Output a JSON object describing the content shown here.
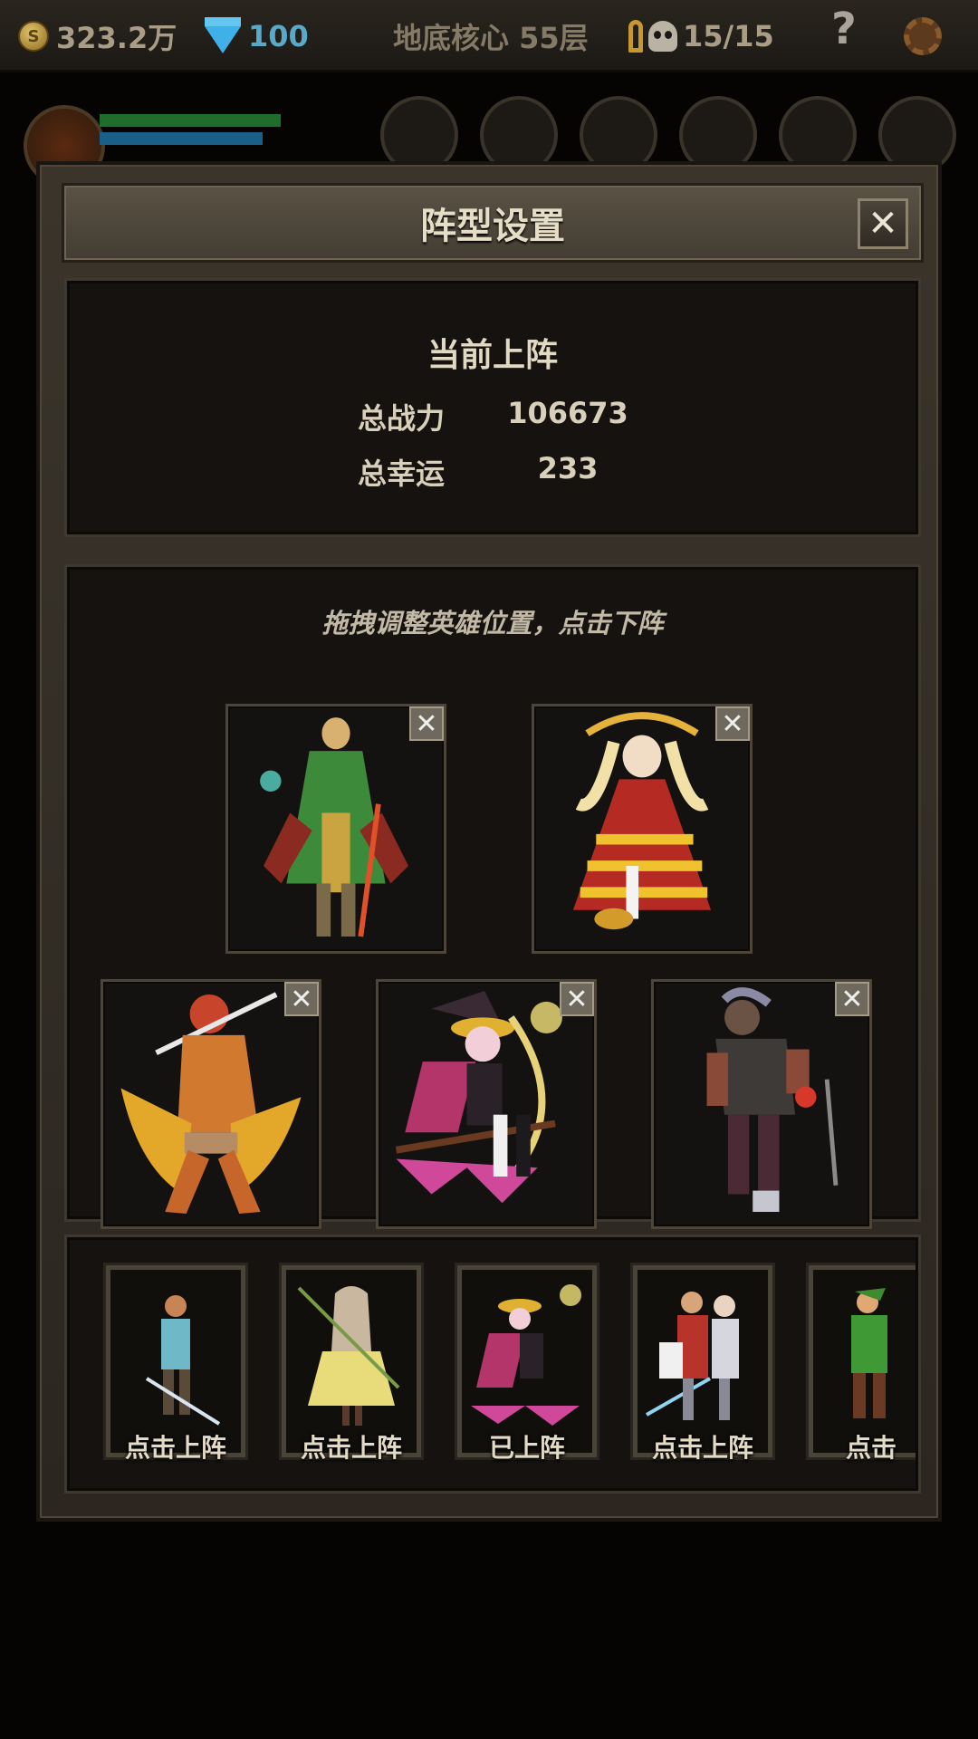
{
  "topbar": {
    "gold": "323.2万",
    "coin_symbol": "S",
    "gems": "100",
    "floor": "地底核心 55层",
    "keys_label": "15/15",
    "help": "?"
  },
  "dialog": {
    "title": "阵型设置",
    "close": "✕",
    "current_title": "当前上阵",
    "total_power_label": "总战力",
    "total_power": "106673",
    "total_luck_label": "总幸运",
    "total_luck": "233",
    "hint": "拖拽调整英雄位置，点击下阵",
    "remove_symbol": "✕"
  },
  "formation": [
    {
      "hero": "green-robed-swordsman"
    },
    {
      "hero": "red-gold-princess"
    },
    {
      "hero": "flame-barbarian"
    },
    {
      "hero": "witch-on-broom"
    },
    {
      "hero": "dark-rogue"
    }
  ],
  "roster": [
    {
      "hero": "blue-swordsman",
      "label": "点击上阵"
    },
    {
      "hero": "staff-priestess",
      "label": "点击上阵"
    },
    {
      "hero": "witch-on-broom",
      "label": "已上阵"
    },
    {
      "hero": "twin-knights",
      "label": "点击上阵"
    },
    {
      "hero": "green-archer",
      "label": "点击"
    }
  ],
  "colors": {
    "gem": "#3fb0e8",
    "gold": "#e2c46a",
    "text": "#e2d9c2"
  }
}
